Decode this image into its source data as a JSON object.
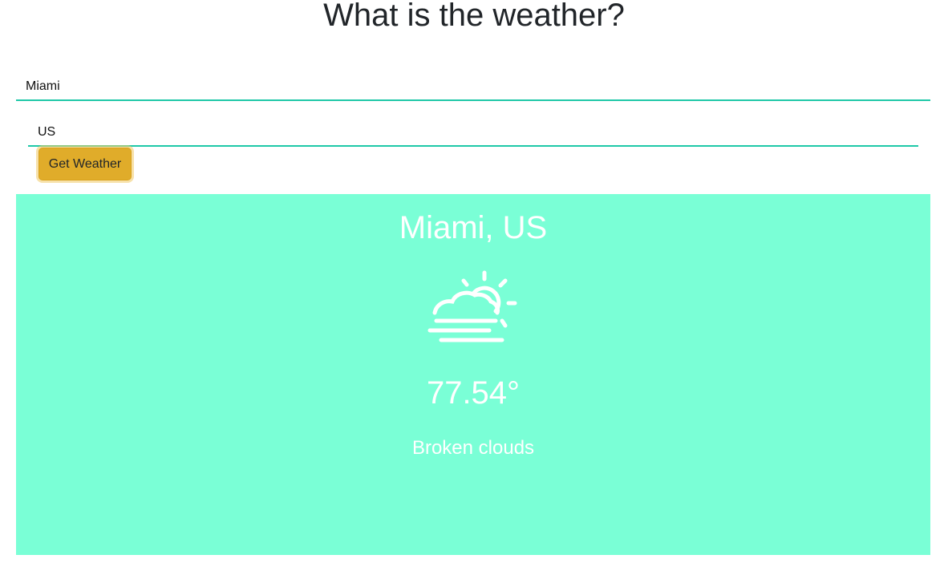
{
  "header": {
    "title": "What is the weather?"
  },
  "form": {
    "city_value": "Miami",
    "country_value": "US",
    "submit_label": "Get Weather"
  },
  "weather": {
    "location": "Miami, US",
    "icon": "partly-cloudy-fog-icon",
    "temperature": "77.54°",
    "description": "Broken clouds"
  },
  "colors": {
    "accent": "#1fc8a8",
    "button": "#e0ac2a",
    "card_background": "#7affd6",
    "card_text": "#ffffff"
  }
}
